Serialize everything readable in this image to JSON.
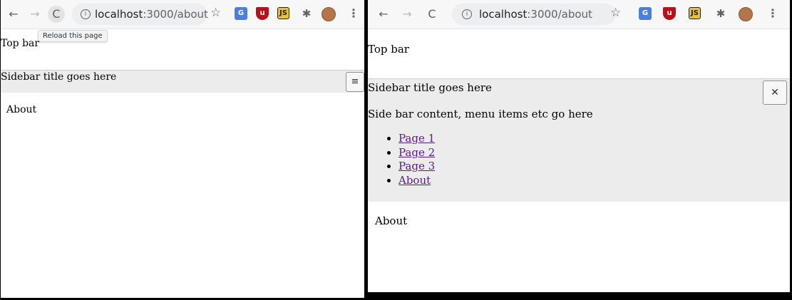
{
  "left": {
    "browser": {
      "url_host": "localhost",
      "url_path": ":3000/about"
    },
    "tooltip": "Reload this page",
    "top_bar": "Top bar",
    "sidebar": {
      "title": "Sidebar title goes here",
      "toggle_icon": "hamburger-icon"
    },
    "main": {
      "text": "About"
    }
  },
  "right": {
    "browser": {
      "url_host": "localhost",
      "url_path": ":3000/about"
    },
    "top_bar": "Top bar",
    "sidebar": {
      "title": "Sidebar title goes here",
      "toggle_icon": "close-icon",
      "content": "Side bar content, menu items etc go here",
      "items": [
        {
          "label": "Page 1"
        },
        {
          "label": "Page 2"
        },
        {
          "label": "Page 3"
        },
        {
          "label": "About"
        }
      ]
    },
    "main": {
      "text": "About"
    }
  }
}
